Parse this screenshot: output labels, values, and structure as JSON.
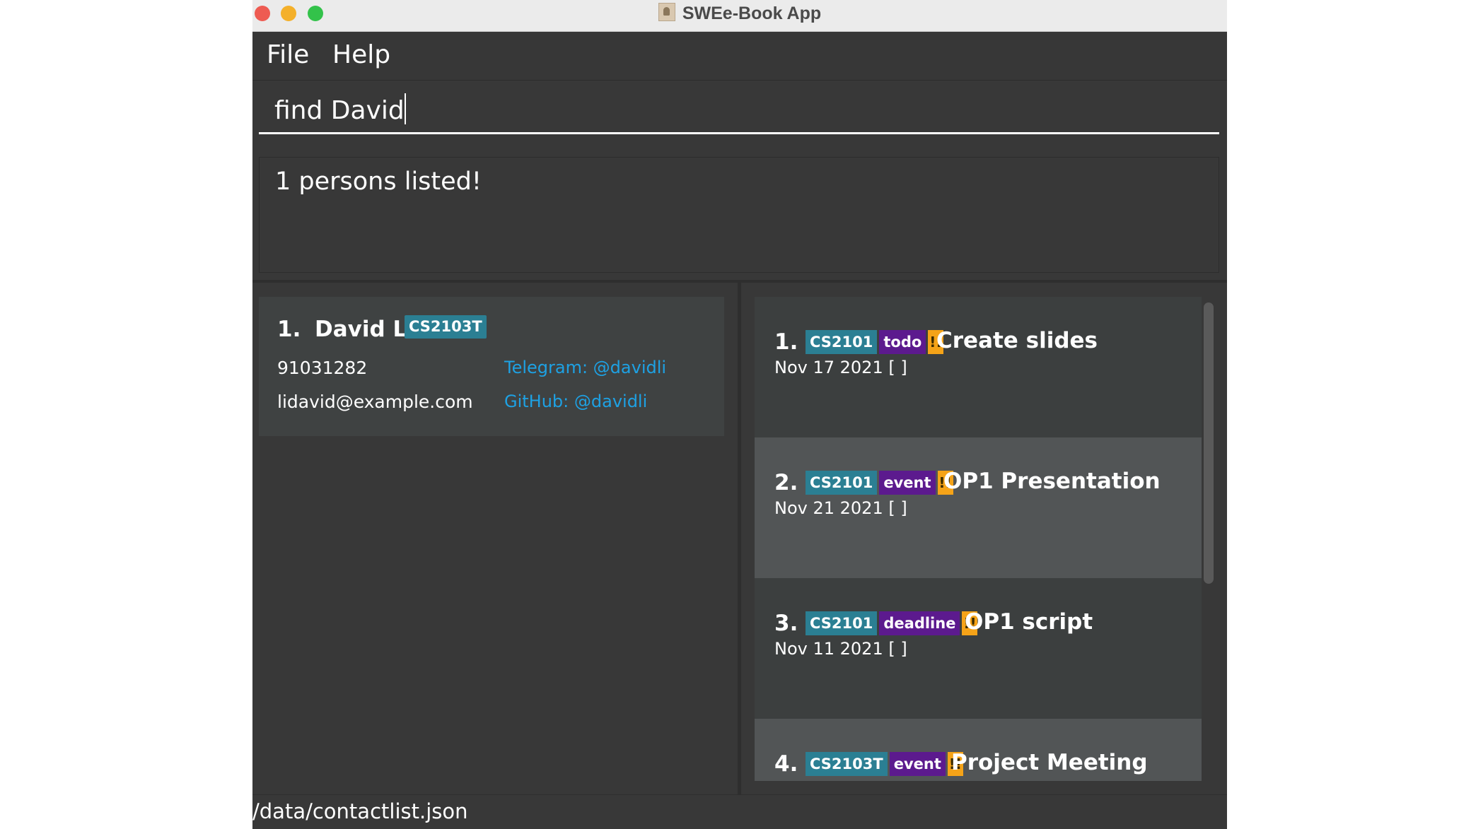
{
  "window": {
    "title": "SWEe-Book App"
  },
  "menu": {
    "file_label": "File",
    "help_label": "Help"
  },
  "command": {
    "value": "find David"
  },
  "result": {
    "message": "1 persons listed!"
  },
  "persons": [
    {
      "index": "1.",
      "name": "David Li",
      "tag": "CS2103T",
      "phone": "91031282",
      "email": "lidavid@example.com",
      "telegram": "Telegram: @davidli",
      "github": "GitHub: @davidli"
    }
  ],
  "tasks": [
    {
      "index": "1.",
      "module": "CS2101",
      "type": "todo",
      "priority": "!!",
      "title": "Create slides",
      "date": "Nov 17 2021 [ ]"
    },
    {
      "index": "2.",
      "module": "CS2101",
      "type": "event",
      "priority": "!!",
      "title": "OP1 Presentation",
      "date": "Nov 21 2021 [ ]"
    },
    {
      "index": "3.",
      "module": "CS2101",
      "type": "deadline",
      "priority": "!!",
      "title": "OP1 script",
      "date": "Nov 11 2021 [ ]"
    },
    {
      "index": "4.",
      "module": "CS2103T",
      "type": "event",
      "priority": "!!",
      "title": "Project Meeting",
      "date": ""
    }
  ],
  "status": {
    "path": "/data/contactlist.json"
  },
  "colors": {
    "module_tag": "#2b7f93",
    "type_tag": "#5c1a8e",
    "priority_tag": "#f5a318",
    "link": "#1ea1e3"
  }
}
